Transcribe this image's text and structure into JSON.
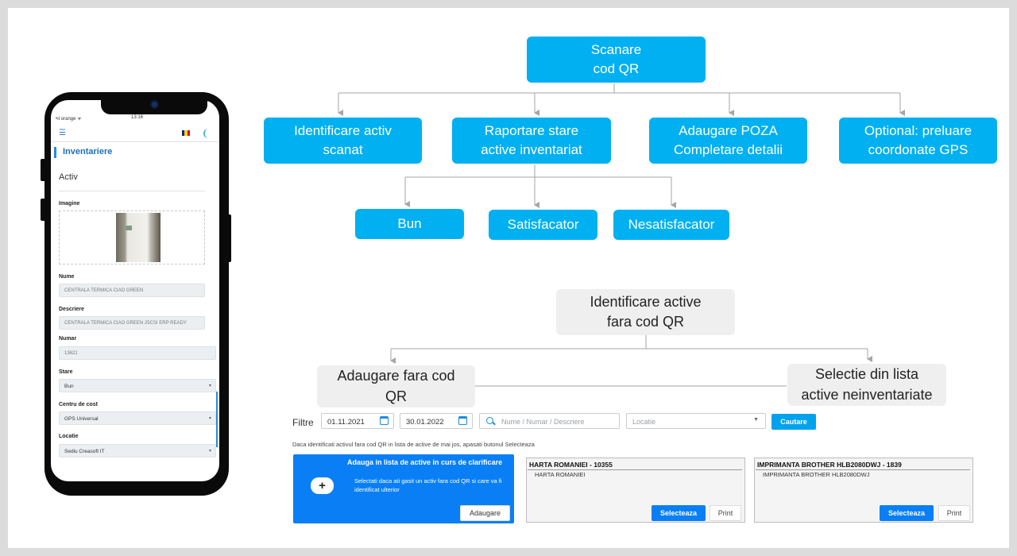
{
  "phone": {
    "status_carrier": "•ıl orange ᯤ",
    "status_time": "13:16",
    "menu_icon": "☰",
    "page_title": "Inventariere",
    "section_title": "Activ",
    "image_label": "Imagine",
    "name_label": "Nume",
    "name_value": "CENTRALA TERMICA CIAO GREEN",
    "description_label": "Descriere",
    "description_value": "CENTRALA TERMICA CIAO GREEN 25CSI ERP READY",
    "number_label": "Numar",
    "number_value": "13621",
    "state_label": "Stare",
    "state_value": "Bun",
    "cost_center_label": "Centru de cost",
    "cost_center_value": "GPS Universal",
    "location_label": "Locatie",
    "location_value": "Sediu Creasoft IT",
    "flag_colors": [
      "#002b7f",
      "#fcd116",
      "#ce1126"
    ]
  },
  "diagram": {
    "root": "Scanare\ncod QR",
    "branches": [
      "Identificare activ\nscanat",
      "Raportare stare\nactive inventariat",
      "Adaugare POZA\nCompletare detalii",
      "Optional: preluare\ncoordonate GPS"
    ],
    "states": [
      "Bun",
      "Satisfacator",
      "Nesatisfacator"
    ],
    "root2": "Identificare active\nfara cod QR",
    "branches2": [
      "Adaugare fara cod\nQR",
      "Selectie din lista\nactive neinventariate"
    ],
    "colors": {
      "blue_node": "#00b0f0",
      "grey_node": "#efefef"
    }
  },
  "desktop": {
    "filter_label": "Filtre",
    "date_from": "01.11.2021",
    "date_to": "30.01.2022",
    "search_placeholder": "Nume / Numar / Descriere",
    "location_placeholder": "Locatie",
    "search_button": "Cautare",
    "hint": "Daca identificati activul fara cod QR in lista de active de mai jos, apasati butonul Selecteaza",
    "add_card": {
      "title": "Adauga in lista de active in curs de clarificare",
      "description": "Selectati daca ati gasit un activ fara cod QR si care va fi identificat ulterior",
      "button": "Adaugare",
      "plus_icon": "+"
    },
    "assets": [
      {
        "title": "HARTA ROMANIEI - 10355",
        "subtitle": "HARTA ROMANIEI",
        "select": "Selecteaza",
        "print": "Print"
      },
      {
        "title": "IMPRIMANTA BROTHER HLB2080DWJ - 1839",
        "subtitle": "IMPRIMANTA BROTHER HLB2080DWJ",
        "select": "Selecteaza",
        "print": "Print"
      }
    ],
    "accent": "#0a7ff5"
  }
}
